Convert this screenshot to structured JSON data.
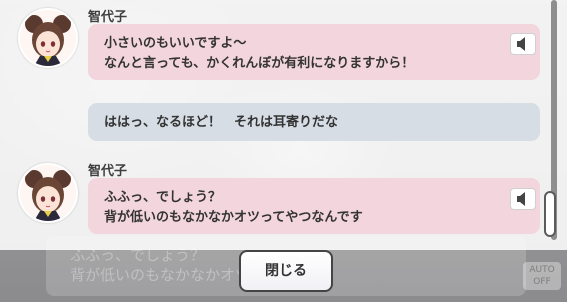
{
  "background": {
    "ghost_lines": [
      "ふふっ、でしょう？",
      "背が低いのもなかなかオツ"
    ],
    "auto_label": "AUTO\nOFF"
  },
  "log": {
    "entries": [
      {
        "speaker": "智代子",
        "lines": [
          "小さいのもいいですよ～",
          "なんと言っても、かくれんぼが有利になりますから！"
        ],
        "style": "pink",
        "has_voice": true,
        "voice_icon": "speaker-icon"
      },
      {
        "speaker": "",
        "lines": [
          "ははっ、なるほど！　それは耳寄りだな"
        ],
        "style": "grey",
        "has_voice": false
      },
      {
        "speaker": "智代子",
        "lines": [
          "ふふっ、でしょう？",
          "背が低いのもなかなかオツってやつなんです"
        ],
        "style": "pink",
        "has_voice": true,
        "voice_icon": "speaker-icon"
      }
    ]
  },
  "close_button": {
    "label": "閉じる"
  },
  "colors": {
    "player_bubble": "#d6dde5",
    "character_bubble": "#f2d5dd",
    "accent": "#444444"
  }
}
